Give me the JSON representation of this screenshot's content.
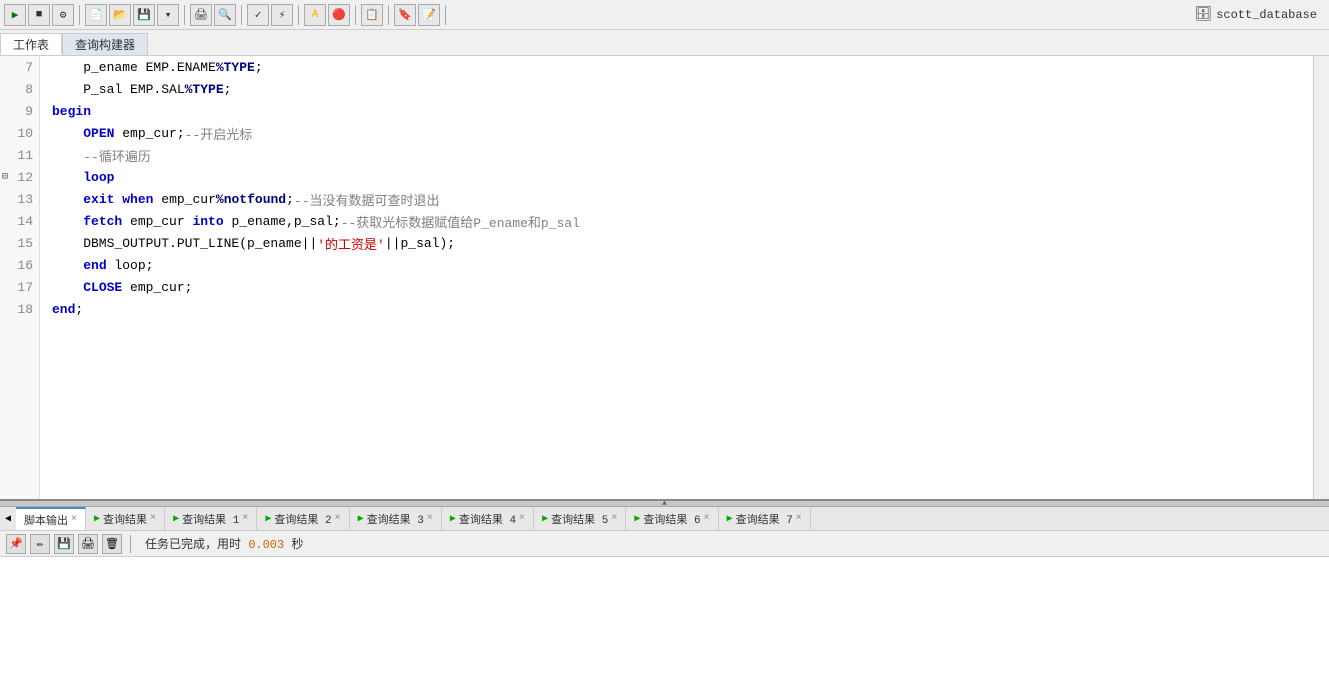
{
  "toolbar": {
    "db_icon": "🗄",
    "db_label": "scott_database",
    "buttons": [
      "▶",
      "⏹",
      "⚙",
      "📄",
      "🔍",
      "✏",
      "🔴",
      "📋",
      "📝",
      "⚡",
      "🔖"
    ],
    "run_label": "Run",
    "stop_label": "Stop"
  },
  "tabs": [
    {
      "label": "工作表",
      "active": true
    },
    {
      "label": "查询构建器",
      "active": false
    }
  ],
  "code_lines": [
    {
      "num": 7,
      "tokens": [
        {
          "text": "    p_ename EMP.ENAME",
          "class": "normal"
        },
        {
          "text": "%TYPE",
          "class": "kw-dark-blue"
        },
        {
          "text": ";",
          "class": "normal"
        }
      ]
    },
    {
      "num": 8,
      "tokens": [
        {
          "text": "    P_sal EMP.SAL",
          "class": "normal"
        },
        {
          "text": "%TYPE",
          "class": "kw-dark-blue"
        },
        {
          "text": ";",
          "class": "normal"
        }
      ]
    },
    {
      "num": 9,
      "tokens": [
        {
          "text": "begin",
          "class": "kw-blue"
        }
      ]
    },
    {
      "num": 10,
      "tokens": [
        {
          "text": "    ",
          "class": "normal"
        },
        {
          "text": "OPEN",
          "class": "kw-blue"
        },
        {
          "text": " emp_cur;",
          "class": "normal"
        },
        {
          "text": "--开启光标",
          "class": "comment"
        }
      ]
    },
    {
      "num": 11,
      "tokens": [
        {
          "text": "    ",
          "class": "normal"
        },
        {
          "text": "--循环遍历",
          "class": "comment"
        }
      ]
    },
    {
      "num": 12,
      "fold": true,
      "tokens": [
        {
          "text": "    ",
          "class": "normal"
        },
        {
          "text": "loop",
          "class": "kw-blue"
        }
      ]
    },
    {
      "num": 13,
      "tokens": [
        {
          "text": "    ",
          "class": "normal"
        },
        {
          "text": "exit",
          "class": "kw-blue"
        },
        {
          "text": " ",
          "class": "normal"
        },
        {
          "text": "when",
          "class": "kw-blue"
        },
        {
          "text": " emp_cur",
          "class": "normal"
        },
        {
          "text": "%notfound",
          "class": "kw-dark-blue"
        },
        {
          "text": ";",
          "class": "normal"
        },
        {
          "text": "--当没有数据可查时退出",
          "class": "comment"
        }
      ]
    },
    {
      "num": 14,
      "tokens": [
        {
          "text": "    ",
          "class": "normal"
        },
        {
          "text": "fetch",
          "class": "kw-blue"
        },
        {
          "text": " emp_cur ",
          "class": "normal"
        },
        {
          "text": "into",
          "class": "kw-blue"
        },
        {
          "text": " p_ename,p_sal;",
          "class": "normal"
        },
        {
          "text": "--获取光标数据赋值给P_ename和p_sal",
          "class": "comment"
        }
      ]
    },
    {
      "num": 15,
      "tokens": [
        {
          "text": "    DBMS_OUTPUT.PUT_LINE(p_ename||",
          "class": "normal"
        },
        {
          "text": "'的工资是'",
          "class": "string"
        },
        {
          "text": "||p_sal);",
          "class": "normal"
        }
      ]
    },
    {
      "num": 16,
      "tokens": [
        {
          "text": "    ",
          "class": "normal"
        },
        {
          "text": "end",
          "class": "kw-blue"
        },
        {
          "text": " loop;",
          "class": "normal"
        }
      ]
    },
    {
      "num": 17,
      "tokens": [
        {
          "text": "    ",
          "class": "normal"
        },
        {
          "text": "CLOSE",
          "class": "kw-blue"
        },
        {
          "text": " emp_cur;",
          "class": "normal"
        }
      ]
    },
    {
      "num": 18,
      "tokens": [
        {
          "text": "end",
          "class": "kw-blue"
        },
        {
          "text": ";",
          "class": "normal"
        }
      ]
    }
  ],
  "bottom_tabs": [
    {
      "label": "脚本输出",
      "active": true,
      "closable": true,
      "has_play": false
    },
    {
      "label": "查询结果",
      "active": false,
      "closable": true,
      "has_play": true
    },
    {
      "label": "查询结果 1",
      "active": false,
      "closable": true,
      "has_play": true
    },
    {
      "label": "查询结果 2",
      "active": false,
      "closable": true,
      "has_play": true
    },
    {
      "label": "查询结果 3",
      "active": false,
      "closable": true,
      "has_play": true
    },
    {
      "label": "查询结果 4",
      "active": false,
      "closable": true,
      "has_play": true
    },
    {
      "label": "查询结果 5",
      "active": false,
      "closable": true,
      "has_play": true
    },
    {
      "label": "查询结果 6",
      "active": false,
      "closable": true,
      "has_play": true
    },
    {
      "label": "查询结果 7",
      "active": false,
      "closable": true,
      "has_play": true
    }
  ],
  "status": {
    "text": "任务已完成，用时 ",
    "time": "0.003",
    "unit": " 秒"
  }
}
